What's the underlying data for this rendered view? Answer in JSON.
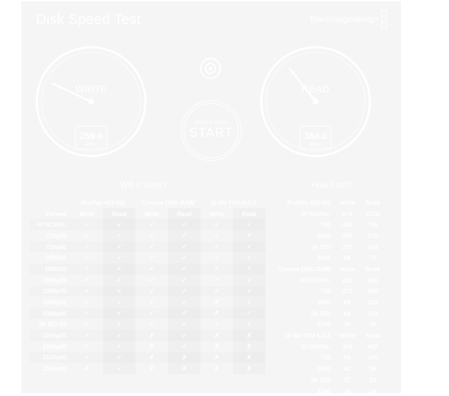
{
  "app": {
    "title": "Disk Speed Test",
    "brand": "Blackmagicdesign"
  },
  "write_gauge": {
    "label": "WRITE",
    "value": "259.6",
    "unit": "MB/s",
    "fraction": 0.26
  },
  "read_gauge": {
    "label": "READ",
    "value": "364.0",
    "unit": "MB/s",
    "fraction": 0.36
  },
  "start_button": {
    "top": "SPEED TEST",
    "main": "START"
  },
  "will_it_work": {
    "title": "Will It Work?",
    "groups": [
      "ProRes 422 HQ",
      "Cinema DNG RAW",
      "10 Bit YUV 4:2:2"
    ],
    "format_label": "Format",
    "sub_headers": [
      "Write",
      "Read",
      "Write",
      "Read",
      "Write",
      "Read"
    ],
    "rows": [
      {
        "label": "NTSC/PAL",
        "cells": [
          "✓",
          "✓",
          "✓",
          "✓",
          "✓",
          "✓"
        ]
      },
      {
        "label": "720p50",
        "cells": [
          "✓",
          "✓",
          "✓",
          "✓",
          "✓",
          "✓"
        ]
      },
      {
        "label": "720p60",
        "cells": [
          "✓",
          "✓",
          "✓",
          "✓",
          "✓",
          "✓"
        ]
      },
      {
        "label": "1080i50",
        "cells": [
          "✓",
          "✓",
          "✓",
          "✓",
          "✓",
          "✓"
        ]
      },
      {
        "label": "1080i60",
        "cells": [
          "✓",
          "✓",
          "✓",
          "✓",
          "✓",
          "✓"
        ]
      },
      {
        "label": "1080p25",
        "cells": [
          "✓",
          "✓",
          "✓",
          "✓",
          "✓",
          "✓"
        ]
      },
      {
        "label": "1080p30",
        "cells": [
          "✓",
          "✓",
          "✓",
          "✓",
          "✓",
          "✓"
        ]
      },
      {
        "label": "1080p50",
        "cells": [
          "✓",
          "✓",
          "✓",
          "✓",
          "✗",
          "✓"
        ]
      },
      {
        "label": "1080p60",
        "cells": [
          "✓",
          "✓",
          "✓",
          "✓",
          "✗",
          "✓"
        ]
      },
      {
        "label": "2K DCI 25",
        "cells": [
          "✓",
          "✓",
          "✓",
          "✓",
          "✓",
          "✓"
        ]
      },
      {
        "label": "2160p25",
        "cells": [
          "✓",
          "✓",
          "✗",
          "✓",
          "✗",
          "✗"
        ]
      },
      {
        "label": "2160p30",
        "cells": [
          "✓",
          "✓",
          "✗",
          "✓",
          "✗",
          "✗"
        ]
      },
      {
        "label": "2160p50",
        "cells": [
          "✓",
          "✓",
          "✗",
          "✗",
          "✗",
          "✗"
        ]
      },
      {
        "label": "2160p60",
        "cells": [
          "✗",
          "✓",
          "✗",
          "✗",
          "✗",
          "✗"
        ]
      }
    ]
  },
  "how_fast": {
    "title": "How Fast?",
    "sections": [
      {
        "name": "ProRes 422 HQ",
        "write": "Write",
        "read": "Read",
        "rows": [
          {
            "label": "NTSC/PAL",
            "write": "674",
            "read": "1318"
          },
          {
            "label": "720",
            "write": "448",
            "read": "766"
          },
          {
            "label": "1080",
            "write": "235",
            "read": "270"
          },
          {
            "label": "2K DCI",
            "write": "217",
            "read": "264"
          },
          {
            "label": "2160",
            "write": "58",
            "read": "72"
          }
        ]
      },
      {
        "name": "Cinema DNG RAW",
        "write": "Write",
        "read": "Read",
        "rows": [
          {
            "label": "NTSC/PAL",
            "write": "222",
            "read": "400"
          },
          {
            "label": "720",
            "write": "212",
            "read": "368"
          },
          {
            "label": "1080",
            "write": "84",
            "read": "120"
          },
          {
            "label": "2K DCI",
            "write": "64",
            "read": "102"
          },
          {
            "label": "2160",
            "write": "16",
            "read": "26"
          }
        ]
      },
      {
        "name": "10 Bit YUV 4:2:2",
        "write": "Write",
        "read": "Read",
        "rows": [
          {
            "label": "NTSC/PAL",
            "write": "316",
            "read": "457"
          },
          {
            "label": "720",
            "write": "84",
            "read": "130"
          },
          {
            "label": "1080",
            "write": "42",
            "read": "58"
          },
          {
            "label": "2K DCI",
            "write": "37",
            "read": "52"
          },
          {
            "label": "2160",
            "write": "10",
            "read": "14"
          }
        ]
      }
    ]
  }
}
